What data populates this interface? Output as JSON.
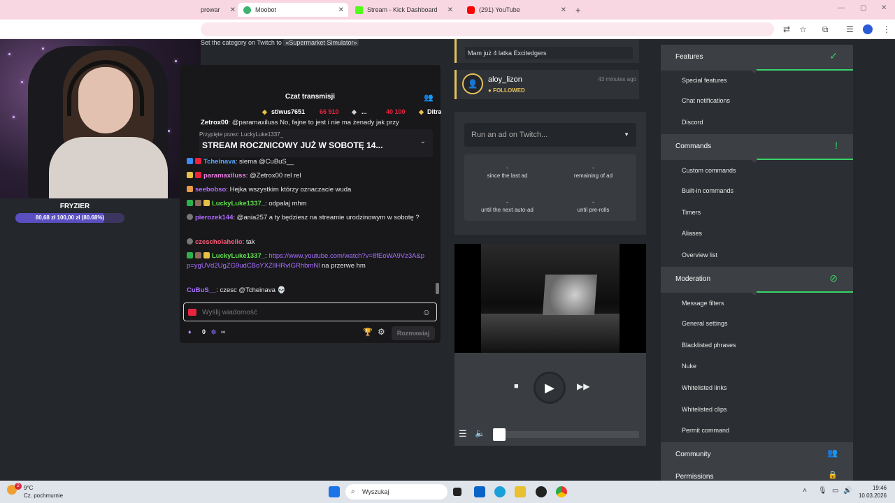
{
  "browser": {
    "tabs": [
      {
        "label": "prowar",
        "active": false,
        "color": "#7b4fd6"
      },
      {
        "label": "Moobot",
        "active": true,
        "color": "#3cb371"
      },
      {
        "label": "Stream - Kick Dashboard",
        "active": false,
        "color": "#53fc18"
      },
      {
        "label": "(291) YouTube",
        "active": false,
        "color": "#ff0000"
      }
    ],
    "new_tab": "+"
  },
  "webcam": {
    "streamer": "FRYZIER",
    "goal_text": "80,68 zł   100,00 zł (80.68%)",
    "goal_fraction": 0.8068
  },
  "category_bar": {
    "prefix": "Set the category on Twitch to",
    "category": "«Supermarket Simulator»"
  },
  "chat": {
    "title": "Czat transmisji",
    "leaderboard": [
      {
        "user": "stiwus7651",
        "amount": "66 910"
      },
      {
        "user": "...",
        "amount": "40 100"
      },
      {
        "user": "Ditra",
        "amount": ""
      }
    ],
    "pinned_by": "Przypięte przez: LuckyLuke1337_",
    "pinned_message": "STREAM ROCZNICOWY JUŻ W SOBOTĘ 14...",
    "messages": [
      {
        "user": "Zetrox00",
        "color": "#ffffff",
        "text": ": @paramaxiluss No, fajne to jest i nie ma żenady jak przy"
      },
      {
        "user": "Tcheinava",
        "color": "#5aa7ff",
        "text": ": siema @CuBuS__"
      },
      {
        "user": "paramaxiluss",
        "color": "#e97fe0",
        "text": ": @Zetrox00 rel rel"
      },
      {
        "user": "seebobso",
        "color": "#b06bff",
        "text": ": Hejka wszystkim którzy oznaczacie wuda"
      },
      {
        "user": "LuckyLuke1337_",
        "color": "#5fe04c",
        "text": ": odpalaj mhm"
      },
      {
        "user": "pierozek144",
        "color": "#b06bff",
        "text": ": @ania257 a ty będziesz na streamie urodzinowym w sobotę ?"
      },
      {
        "user": "czescholahello",
        "color": "#ff5a76",
        "text": ": tak"
      },
      {
        "user": "LuckyLuke1337_",
        "color": "#5fe04c",
        "text": ": ",
        "link": "https://www.youtube.com/watch?v=8fEoWA9Vz3A&pp=ygUVd2UgZG9udCBoYXZlIHRvIGRhbmNl",
        "after": " na przerwe hm"
      },
      {
        "user": "CuBuS__",
        "color": "#a970ff",
        "text": ": czesc @Tcheinava 💀"
      }
    ],
    "input_placeholder": "Wyślij wiadomość",
    "points": "0",
    "infinity": "∞",
    "send_label": "Rozmawiaj"
  },
  "events": {
    "first_message": "Mam już 4 latka Excitedgers",
    "follower": {
      "name": "aloy_lizon",
      "status": "FOLLOWED",
      "time": "43 minutes ago"
    }
  },
  "ads": {
    "select_placeholder": "Run an ad on Twitch...",
    "stats": [
      {
        "value": "-",
        "label": "since the last ad"
      },
      {
        "value": "-",
        "label": "remaining of ad"
      },
      {
        "value": "-",
        "label": "until the next auto-ad"
      },
      {
        "value": "-",
        "label": "until pre-rolls"
      }
    ]
  },
  "player": {
    "progress": 0
  },
  "sidebar": {
    "sections": [
      {
        "label": "Features",
        "icon": "✓",
        "icon_color": "#3ad36a",
        "items": [
          "Special features",
          "Chat notifications",
          "Discord"
        ]
      },
      {
        "label": "Commands",
        "icon": "!",
        "icon_color": "#3ad36a",
        "items": [
          "Custom commands",
          "Built-in commands",
          "Timers",
          "Aliases",
          "Overview list"
        ]
      },
      {
        "label": "Moderation",
        "icon": "⊘",
        "icon_color": "#3ad36a",
        "items": [
          "Message filters",
          "General settings",
          "Blacklisted phrases",
          "Nuke",
          "Whitelisted links",
          "Whitelisted clips",
          "Permit command"
        ]
      },
      {
        "label": "Community",
        "icon": "👥",
        "icon_color": "#cccccc",
        "items": []
      },
      {
        "label": "Permissions",
        "icon": "🔒",
        "icon_color": "#3ad36a",
        "items": []
      }
    ]
  },
  "taskbar": {
    "weather_temp": "9°C",
    "weather_desc": "Cz. pochmurnie",
    "weather_badge": "2",
    "search": "Wyszukaj",
    "time": "19:46",
    "date": "10.03.2026"
  }
}
